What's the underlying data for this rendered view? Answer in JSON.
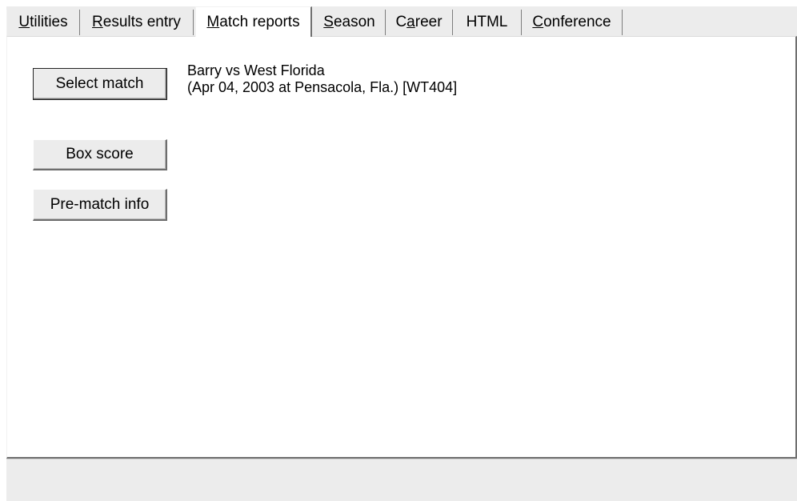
{
  "tabs": [
    {
      "pre": "",
      "mn": "U",
      "post": "tilities"
    },
    {
      "pre": "",
      "mn": "R",
      "post": "esults entry"
    },
    {
      "pre": "",
      "mn": "M",
      "post": "atch reports"
    },
    {
      "pre": "",
      "mn": "S",
      "post": "eason"
    },
    {
      "pre": "C",
      "mn": "a",
      "post": "reer"
    },
    {
      "pre": "HTML",
      "mn": "",
      "post": ""
    },
    {
      "pre": "",
      "mn": "C",
      "post": "onference"
    }
  ],
  "active_tab": "Match reports",
  "buttons": {
    "select_match": "Select match",
    "box_score": "Box score",
    "pre_match_info": "Pre-match info"
  },
  "match": {
    "title": "Barry vs West Florida",
    "details": "(Apr 04, 2003 at Pensacola, Fla.) [WT404]"
  },
  "status": ""
}
